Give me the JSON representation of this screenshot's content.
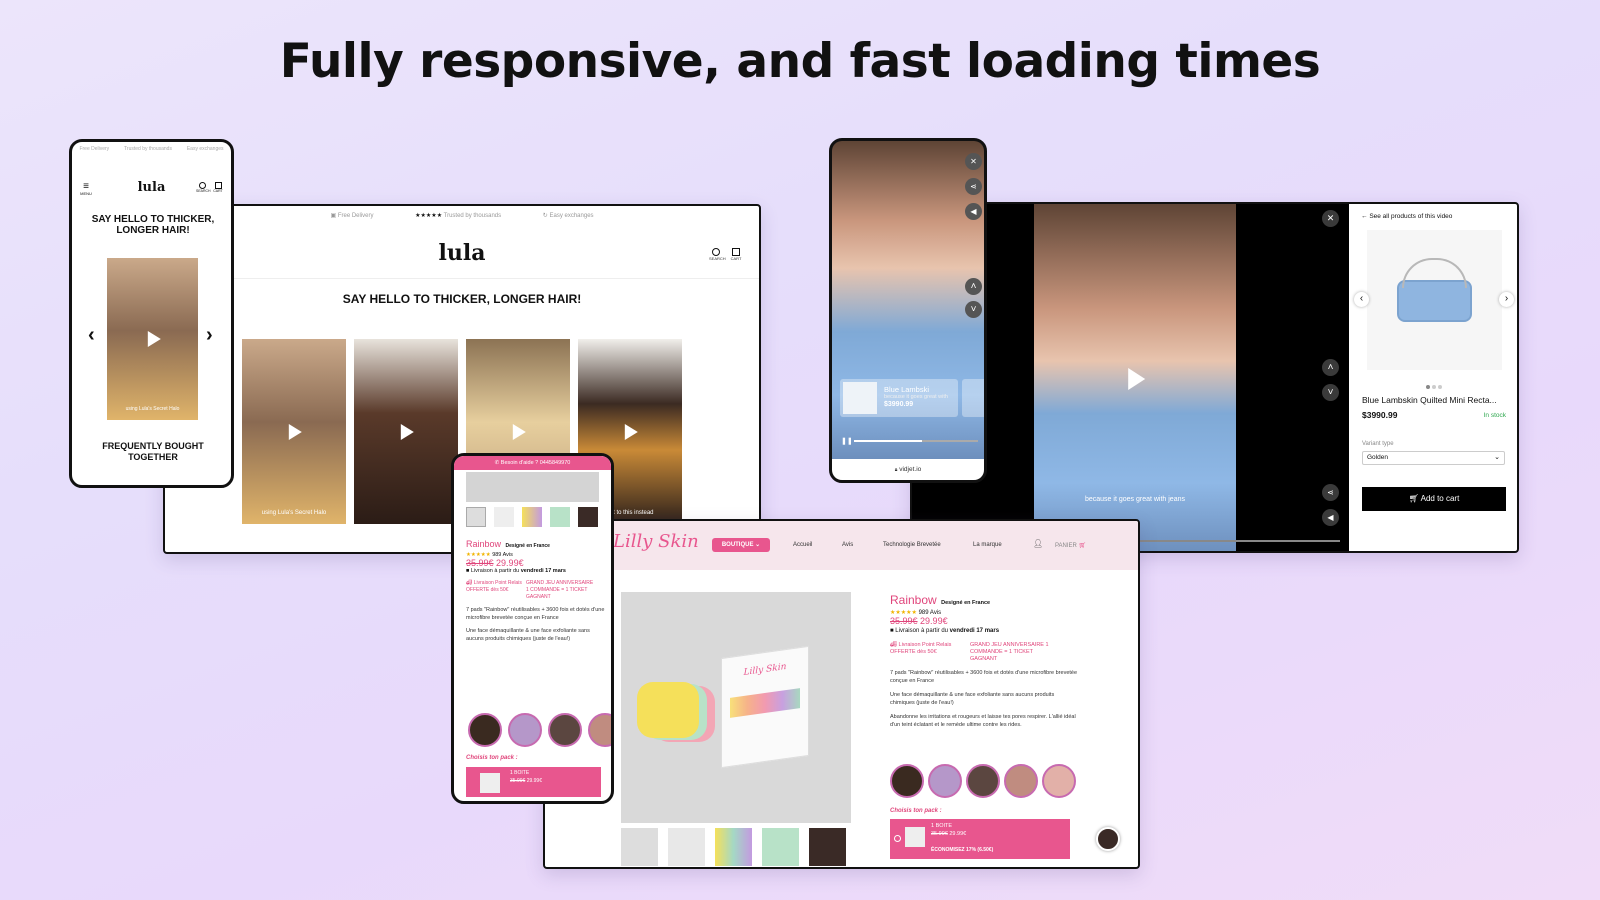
{
  "headline": "Fully responsive, and fast loading times",
  "lula": {
    "logo": "lula",
    "topbar": [
      "Free Delivery",
      "Trusted by thousands",
      "Easy exchanges"
    ],
    "stars": "★★★★★",
    "menu_label": "MENU",
    "search_label": "SEARCH",
    "cart_label": "CART",
    "heading_mobile": "SAY HELLO TO THICKER, LONGER HAIR!",
    "heading_desktop": "SAY HELLO TO THICKER, LONGER HAIR!",
    "video_caption_1": "using Lula's Secret Halo",
    "video_caption_4": "get to this instead",
    "frequently": "FREQUENTLY BOUGHT TOGETHER",
    "prev": "‹",
    "next": "›"
  },
  "vidjet": {
    "product_mini_title": "Blue Lambski",
    "product_mini_price": "$3990.99",
    "subtitle_mini": "because it goes great with",
    "url": "vidjet.io",
    "subtitle": "because it goes great with jeans",
    "back_link": "See all products of this video",
    "product_title": "Blue Lambskin Quilted Mini Recta...",
    "price": "$3990.99",
    "stock": "In stock",
    "variant_label": "Variant type",
    "variant_value": "Golden",
    "add_to_cart": "Add to cart",
    "close": "✕"
  },
  "lilly": {
    "logo": "Lilly Skin",
    "help_bar": "Besoin d'aide ? 0445849970",
    "nav": [
      "BOUTIQUE",
      "Accueil",
      "Avis",
      "Technologie Brevetée",
      "La marque"
    ],
    "panier": "PANIER",
    "product_name": "Rainbow",
    "designed": "Designé en France",
    "reviews": "989 Avis",
    "stars": "★★★★★",
    "old_price": "35.99€",
    "new_price": "29.99€",
    "delivery_prefix": "Livraison à partir du",
    "delivery_date": "vendredi 17 mars",
    "relay": "Livraison Point Relais OFFERTE dès 50€",
    "contest": "GRAND JEU ANNIVERSAIRE 1 COMMANDE = 1 TICKET GAGNANT",
    "desc1": "7 pads \"Rainbow\" réutilisables + 3600 fois et dotés d'une microfibre brevetée conçue en France",
    "desc2": "Une face démaquillante & une face exfoliante sans aucuns produits chimiques (juste de l'eau!)",
    "desc3": "Abandonne les irritations et rougeurs et laisse tes pores respirer. L'allié idéal d'un teint éclatant et le remède ultime contre les rides.",
    "choose_pack": "Choisis ton pack :",
    "pack_title": "1 BOITE",
    "pack_old": "35.99€",
    "pack_new": "29.99€",
    "pack_save": "ÉCONOMISEZ 17% (6.50€)",
    "box_brand": "Lilly Skin"
  },
  "colors": {
    "pink": "#e8568e",
    "accent_text": "#e0457b",
    "stock_green": "#2fa84f",
    "star_yellow": "#f1b400"
  }
}
